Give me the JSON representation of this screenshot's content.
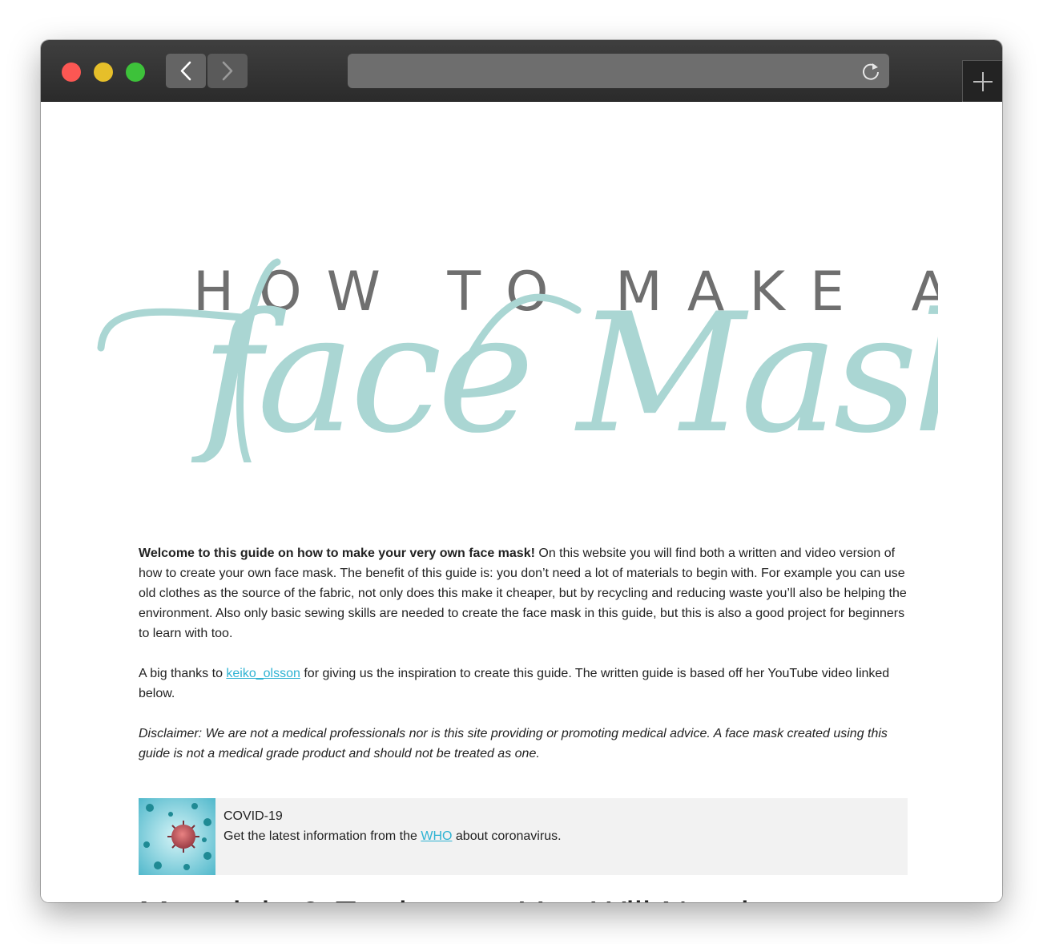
{
  "browser": {
    "back_icon": "chevron-left-icon",
    "forward_icon": "chevron-right-icon",
    "reload_icon": "reload-icon",
    "new_tab_icon": "plus-icon",
    "address": ""
  },
  "hero": {
    "line1": "HOW TO MAKE A",
    "line2": "face Mask",
    "line1_color": "#6f6f6f",
    "script_color": "#aad6d3"
  },
  "intro": {
    "bold": "Welcome to this guide on how to make your very own face mask!",
    "rest": " On this website you will find both a written and video version of how to create your own face mask. The benefit of this guide is: you don’t need a lot of materials to begin with. For example you can use old clothes as the source of the fabric, not only does this make it cheaper, but by recycling and reducing waste you’ll also be helping the environment. Also only basic sewing skills are needed to create the face mask in this guide, but this is also a good project for beginners to learn with too."
  },
  "thanks": {
    "before": "A big thanks to ",
    "link": "keiko_olsson",
    "after": " for giving us the inspiration to create this guide. The written guide is based off her YouTube video linked below."
  },
  "disclaimer": "Disclaimer: We are not a medical professionals nor is this site providing or promoting medical advice. A face mask created using this guide is not a medical grade product and should not be treated as one.",
  "covid": {
    "title": "COVID-19",
    "before": "Get the latest information from the ",
    "link": "WHO",
    "after": " about coronavirus.",
    "image_icon": "virus-image"
  },
  "materials_heading": "Materials & Equipment You Will Need",
  "colors": {
    "link": "#2fb3d3",
    "titlebar": "#333333"
  }
}
